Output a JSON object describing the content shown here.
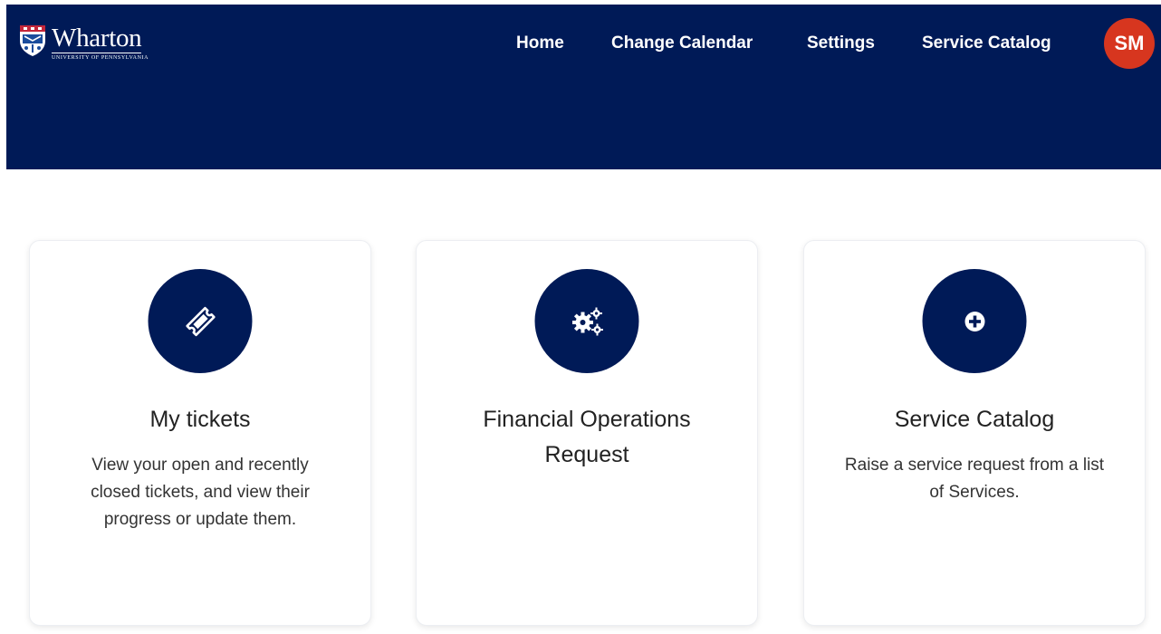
{
  "brand": {
    "name": "Wharton",
    "subtitle": "University of Pennsylvania",
    "header_color": "#001a57",
    "avatar_color": "#d7361f"
  },
  "nav": {
    "home": "Home",
    "change_calendar": "Change Calendar",
    "settings": "Settings",
    "service_catalog": "Service Catalog"
  },
  "user": {
    "initials": "SM"
  },
  "cards": [
    {
      "icon": "ticket-icon",
      "title": "My tickets",
      "description": "View your open and recently closed tickets, and view their progress or update them."
    },
    {
      "icon": "gears-icon",
      "title": "Financial Operations Request",
      "description": ""
    },
    {
      "icon": "plus-circle-icon",
      "title": "Service Catalog",
      "description": "Raise a service request from a list of Services."
    }
  ]
}
